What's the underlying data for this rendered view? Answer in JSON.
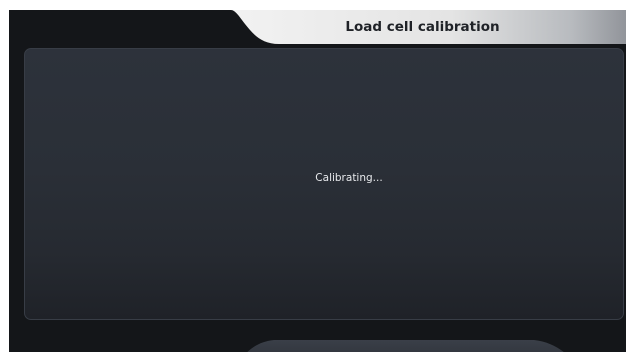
{
  "header": {
    "title": "Load cell calibration"
  },
  "main": {
    "status": "Calibrating..."
  },
  "colors": {
    "background": "#141619",
    "panel": "#2a2f37",
    "title_tab_light": "#f4f4f4",
    "title_tab_dark": "#9a9da2",
    "text_light": "#e6e8eb",
    "text_dark": "#1f2227"
  }
}
